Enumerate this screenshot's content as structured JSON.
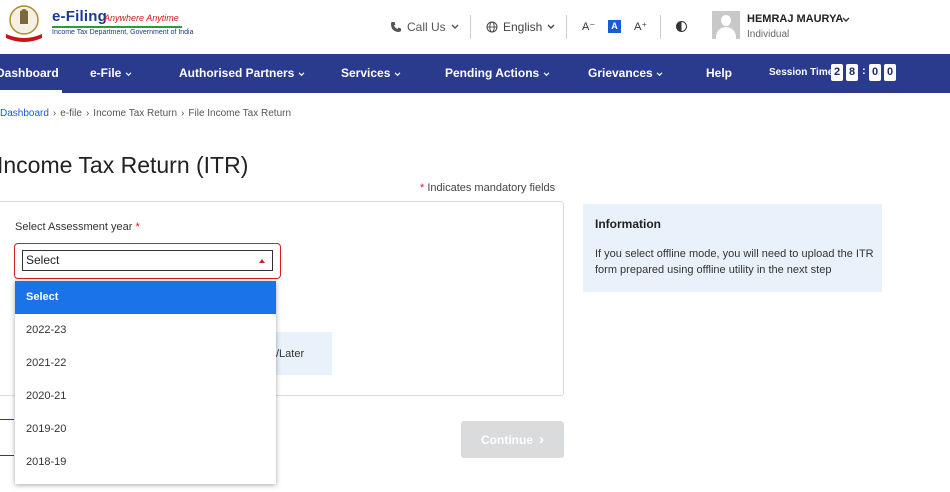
{
  "logo": {
    "title": "e-Filing",
    "tagline": "Anywhere Anytime",
    "subtitle": "Income Tax Department, Government of India"
  },
  "header": {
    "call_us": "Call Us",
    "language": "English",
    "font_decrease": "A⁻",
    "font_normal": "A",
    "font_increase": "A⁺",
    "user_name": "HEMRAJ MAURYA",
    "user_role": "Individual"
  },
  "nav": {
    "items": [
      "Dashboard",
      "e-File",
      "Authorised Partners",
      "Services",
      "Pending Actions",
      "Grievances",
      "Help"
    ],
    "session_label": "Session Time",
    "session_digits": [
      "2",
      "8",
      "0",
      "0"
    ],
    "session_colon": ":"
  },
  "breadcrumb": [
    "Dashboard",
    "e-file",
    "Income Tax Return",
    "File Income Tax Return"
  ],
  "page": {
    "title": "Income Tax Return (ITR)",
    "mandatory_star": "*",
    "mandatory_text": "Indicates mandatory fields"
  },
  "form": {
    "ay_label": "Select Assessment year",
    "required_star": "*",
    "selected_value": "Select",
    "mode_partial_text": "/Later",
    "options": [
      "Select",
      "2022-23",
      "2021-22",
      "2020-21",
      "2019-20",
      "2018-19"
    ],
    "continue_label": "Continue",
    "continue_chevron": "›"
  },
  "info": {
    "title": "Information",
    "text": "If you select offline mode, you will need to upload the ITR form prepared using offline utility in the next step"
  },
  "colors": {
    "nav_bg": "#2a3a8c",
    "accent_blue": "#1a73e8",
    "error_red": "#d32020",
    "info_bg": "#e9f2fb"
  }
}
